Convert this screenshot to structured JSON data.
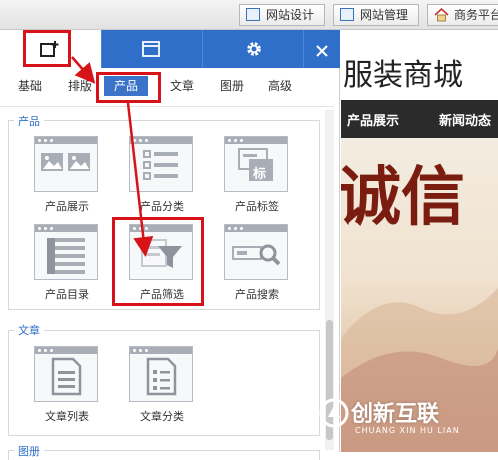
{
  "toolbar": {
    "website_design": "网站设计",
    "website_manage": "网站管理",
    "business_platform": "商务平台"
  },
  "panel": {
    "categories": [
      "基础",
      "排版",
      "产品",
      "文章",
      "图册",
      "高级"
    ],
    "selected_category": "产品",
    "groups": [
      {
        "title": "产品",
        "items": [
          {
            "label": "产品展示",
            "icon": "product-display-icon"
          },
          {
            "label": "产品分类",
            "icon": "product-category-icon"
          },
          {
            "label": "产品标签",
            "icon": "product-tag-icon",
            "glyph": "标"
          },
          {
            "label": "产品目录",
            "icon": "product-directory-icon"
          },
          {
            "label": "产品筛选",
            "icon": "product-filter-icon"
          },
          {
            "label": "产品搜索",
            "icon": "product-search-icon"
          }
        ]
      },
      {
        "title": "文章",
        "items": [
          {
            "label": "文章列表",
            "icon": "article-list-icon"
          },
          {
            "label": "文章分类",
            "icon": "article-category-icon"
          }
        ]
      },
      {
        "title": "图册",
        "items": []
      }
    ]
  },
  "site": {
    "title": "服装商城",
    "nav": [
      "产品展示",
      "新闻动态"
    ],
    "banner_text": "诚信"
  },
  "watermark": {
    "name": "创新互联",
    "sub": "CHUANG XIN HU LIAN"
  },
  "colors": {
    "accent": "#2f6fc9",
    "highlight": "#d71218"
  }
}
